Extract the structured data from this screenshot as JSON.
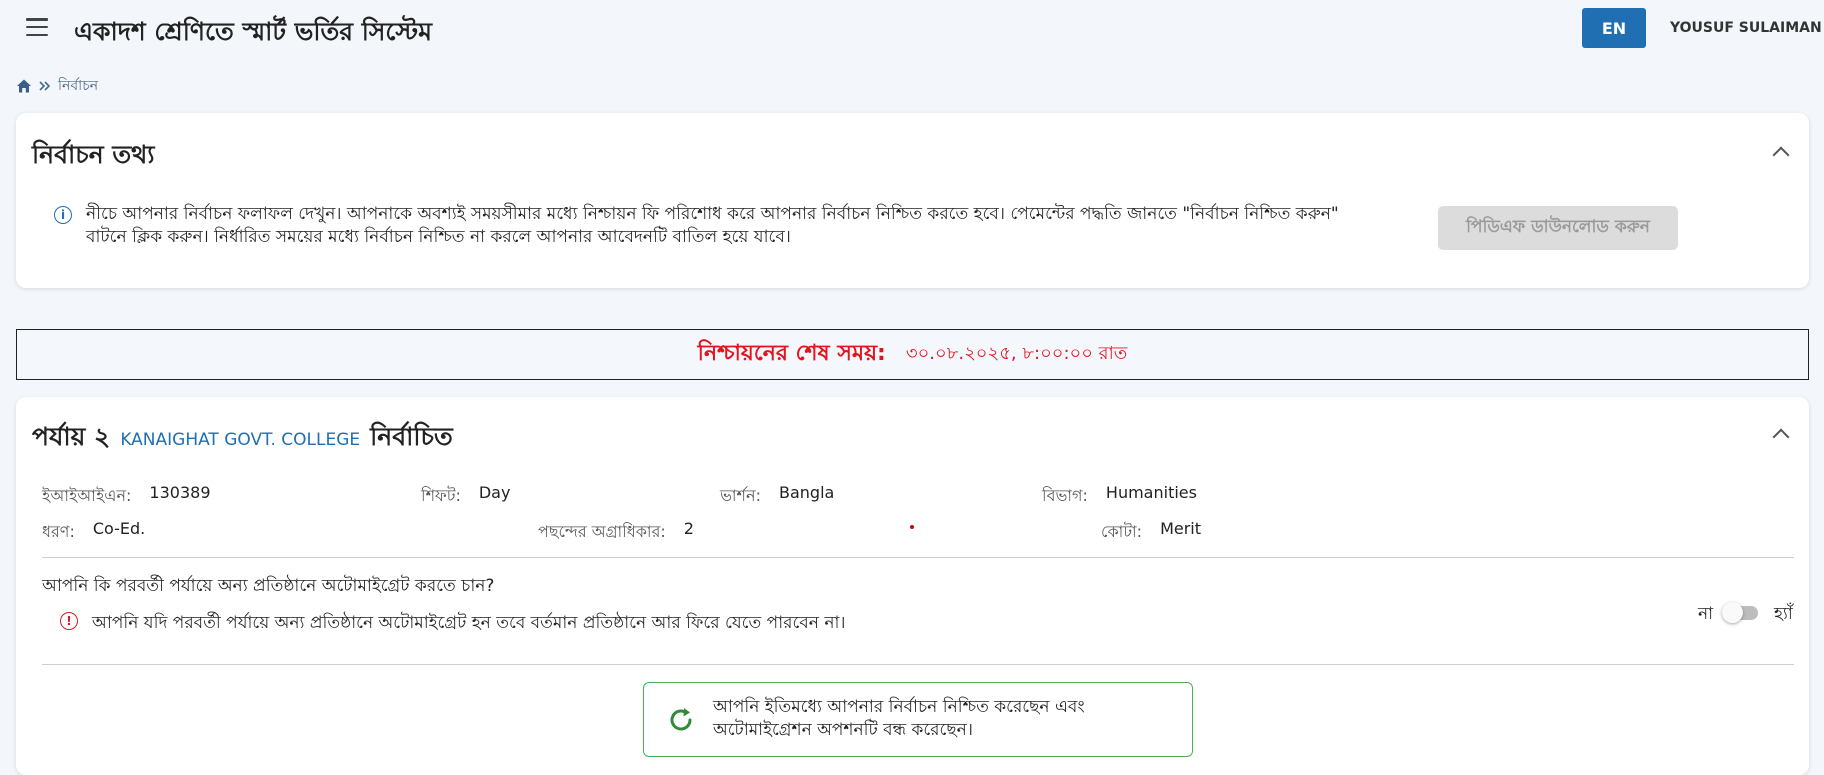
{
  "header": {
    "title": "একাদশ শ্রেণিতে স্মার্ট ভর্তির সিস্টেম",
    "lang_button": "EN",
    "user_name": "YOUSUF SULAIMAN"
  },
  "breadcrumb": {
    "current": "নির্বাচন"
  },
  "info_card": {
    "heading": "নির্বাচন তথ্য",
    "message": "নীচে আপনার নির্বাচন ফলাফল দেখুন। আপনাকে অবশ্যই সময়সীমার মধ্যে নিশ্চায়ন ফি পরিশোধ করে আপনার নির্বাচন নিশ্চিত করতে হবে। পেমেন্টের পদ্ধতি জানতে \"নির্বাচন নিশ্চিত করুন\" বাটনে ক্লিক করুন। নির্ধারিত সময়ের মধ্যে নির্বাচন নিশ্চিত না করলে আপনার আবেদনটি বাতিল হয়ে যাবে।",
    "pdf_button": "পিডিএফ ডাউনলোড করুন"
  },
  "deadline": {
    "label": "নিশ্চায়নের শেষ সময়:",
    "value": "৩০.০৮.২০২৫, ৮:০০:০০ রাত"
  },
  "selection": {
    "phase": "পর্যায় ২",
    "college": "KANAIGHAT GOVT. COLLEGE",
    "status": "নির্বাচিত",
    "eiin_label": "ইআইআইএন:",
    "eiin_value": "130389",
    "shift_label": "শিফট:",
    "shift_value": "Day",
    "version_label": "ভার্শন:",
    "version_value": "Bangla",
    "group_label": "বিভাগ:",
    "group_value": "Humanities",
    "type_label": "ধরণ:",
    "type_value": "Co-Ed.",
    "priority_label": "পছন্দের অগ্রাধিকার:",
    "priority_value": "2",
    "quota_label": "কোটা:",
    "quota_value": "Merit",
    "automigration_question": "আপনি কি পরবর্তী পর্যায়ে অন্য প্রতিষ্ঠানে অটোমাইগ্রেট করতে চান?",
    "automigration_warning": "আপনি যদি পরবর্তী পর্যায়ে অন্য প্রতিষ্ঠানে অটোমাইগ্রেট হন তবে বর্তমান প্রতিষ্ঠানে আর ফিরে যেতে পারবেন না।",
    "toggle_no": "না",
    "toggle_yes": "হ্যাঁ",
    "toggle_state": "off",
    "confirmed_message": "আপনি ইতিমধ্যে আপনার নির্বাচন নিশ্চিত করেছেন এবং অটোমাইগ্রেশন অপশনটি বন্ধ করেছেন।"
  },
  "colors": {
    "accent": "#1f6fb2",
    "deadline_red": "#e4131c",
    "success_green": "#4caf50",
    "warning_red": "#d0202a"
  }
}
